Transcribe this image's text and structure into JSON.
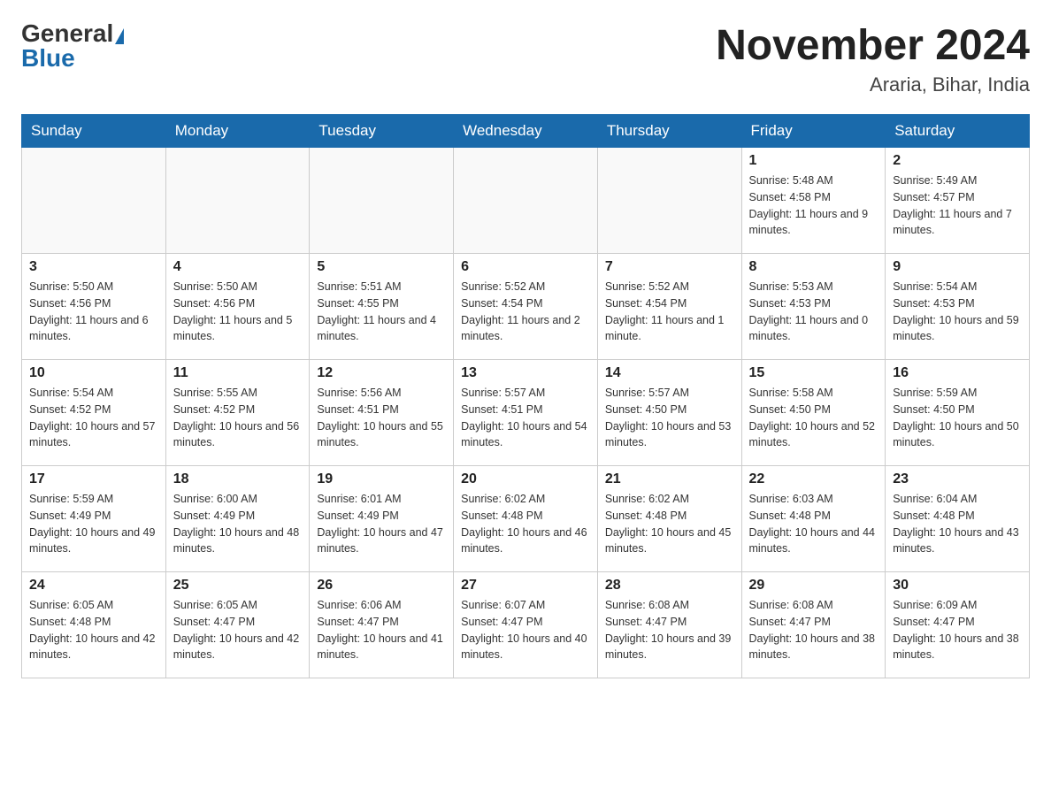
{
  "logo": {
    "general": "General",
    "blue": "Blue"
  },
  "title": "November 2024",
  "subtitle": "Araria, Bihar, India",
  "weekdays": [
    "Sunday",
    "Monday",
    "Tuesday",
    "Wednesday",
    "Thursday",
    "Friday",
    "Saturday"
  ],
  "weeks": [
    [
      {
        "day": "",
        "info": ""
      },
      {
        "day": "",
        "info": ""
      },
      {
        "day": "",
        "info": ""
      },
      {
        "day": "",
        "info": ""
      },
      {
        "day": "",
        "info": ""
      },
      {
        "day": "1",
        "info": "Sunrise: 5:48 AM\nSunset: 4:58 PM\nDaylight: 11 hours and 9 minutes."
      },
      {
        "day": "2",
        "info": "Sunrise: 5:49 AM\nSunset: 4:57 PM\nDaylight: 11 hours and 7 minutes."
      }
    ],
    [
      {
        "day": "3",
        "info": "Sunrise: 5:50 AM\nSunset: 4:56 PM\nDaylight: 11 hours and 6 minutes."
      },
      {
        "day": "4",
        "info": "Sunrise: 5:50 AM\nSunset: 4:56 PM\nDaylight: 11 hours and 5 minutes."
      },
      {
        "day": "5",
        "info": "Sunrise: 5:51 AM\nSunset: 4:55 PM\nDaylight: 11 hours and 4 minutes."
      },
      {
        "day": "6",
        "info": "Sunrise: 5:52 AM\nSunset: 4:54 PM\nDaylight: 11 hours and 2 minutes."
      },
      {
        "day": "7",
        "info": "Sunrise: 5:52 AM\nSunset: 4:54 PM\nDaylight: 11 hours and 1 minute."
      },
      {
        "day": "8",
        "info": "Sunrise: 5:53 AM\nSunset: 4:53 PM\nDaylight: 11 hours and 0 minutes."
      },
      {
        "day": "9",
        "info": "Sunrise: 5:54 AM\nSunset: 4:53 PM\nDaylight: 10 hours and 59 minutes."
      }
    ],
    [
      {
        "day": "10",
        "info": "Sunrise: 5:54 AM\nSunset: 4:52 PM\nDaylight: 10 hours and 57 minutes."
      },
      {
        "day": "11",
        "info": "Sunrise: 5:55 AM\nSunset: 4:52 PM\nDaylight: 10 hours and 56 minutes."
      },
      {
        "day": "12",
        "info": "Sunrise: 5:56 AM\nSunset: 4:51 PM\nDaylight: 10 hours and 55 minutes."
      },
      {
        "day": "13",
        "info": "Sunrise: 5:57 AM\nSunset: 4:51 PM\nDaylight: 10 hours and 54 minutes."
      },
      {
        "day": "14",
        "info": "Sunrise: 5:57 AM\nSunset: 4:50 PM\nDaylight: 10 hours and 53 minutes."
      },
      {
        "day": "15",
        "info": "Sunrise: 5:58 AM\nSunset: 4:50 PM\nDaylight: 10 hours and 52 minutes."
      },
      {
        "day": "16",
        "info": "Sunrise: 5:59 AM\nSunset: 4:50 PM\nDaylight: 10 hours and 50 minutes."
      }
    ],
    [
      {
        "day": "17",
        "info": "Sunrise: 5:59 AM\nSunset: 4:49 PM\nDaylight: 10 hours and 49 minutes."
      },
      {
        "day": "18",
        "info": "Sunrise: 6:00 AM\nSunset: 4:49 PM\nDaylight: 10 hours and 48 minutes."
      },
      {
        "day": "19",
        "info": "Sunrise: 6:01 AM\nSunset: 4:49 PM\nDaylight: 10 hours and 47 minutes."
      },
      {
        "day": "20",
        "info": "Sunrise: 6:02 AM\nSunset: 4:48 PM\nDaylight: 10 hours and 46 minutes."
      },
      {
        "day": "21",
        "info": "Sunrise: 6:02 AM\nSunset: 4:48 PM\nDaylight: 10 hours and 45 minutes."
      },
      {
        "day": "22",
        "info": "Sunrise: 6:03 AM\nSunset: 4:48 PM\nDaylight: 10 hours and 44 minutes."
      },
      {
        "day": "23",
        "info": "Sunrise: 6:04 AM\nSunset: 4:48 PM\nDaylight: 10 hours and 43 minutes."
      }
    ],
    [
      {
        "day": "24",
        "info": "Sunrise: 6:05 AM\nSunset: 4:48 PM\nDaylight: 10 hours and 42 minutes."
      },
      {
        "day": "25",
        "info": "Sunrise: 6:05 AM\nSunset: 4:47 PM\nDaylight: 10 hours and 42 minutes."
      },
      {
        "day": "26",
        "info": "Sunrise: 6:06 AM\nSunset: 4:47 PM\nDaylight: 10 hours and 41 minutes."
      },
      {
        "day": "27",
        "info": "Sunrise: 6:07 AM\nSunset: 4:47 PM\nDaylight: 10 hours and 40 minutes."
      },
      {
        "day": "28",
        "info": "Sunrise: 6:08 AM\nSunset: 4:47 PM\nDaylight: 10 hours and 39 minutes."
      },
      {
        "day": "29",
        "info": "Sunrise: 6:08 AM\nSunset: 4:47 PM\nDaylight: 10 hours and 38 minutes."
      },
      {
        "day": "30",
        "info": "Sunrise: 6:09 AM\nSunset: 4:47 PM\nDaylight: 10 hours and 38 minutes."
      }
    ]
  ]
}
